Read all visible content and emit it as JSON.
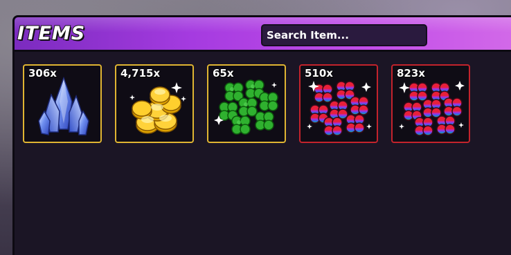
{
  "header": {
    "title": "ITEMS",
    "search_placeholder": "Search Item..."
  },
  "colors": {
    "header_gradient_start": "#7b2bbf",
    "header_gradient_end": "#d36be8",
    "panel_bg": "#1b1525",
    "slot_border_gold": "#e0b532",
    "slot_border_red": "#c4232c"
  },
  "items": [
    {
      "count": "306x",
      "icon": "blue-crystal-icon",
      "rarity_border": "gold"
    },
    {
      "count": "4,715x",
      "icon": "gold-coins-icon",
      "rarity_border": "gold"
    },
    {
      "count": "65x",
      "icon": "green-clover-icon",
      "rarity_border": "gold"
    },
    {
      "count": "510x",
      "icon": "rainbow-clover-icon",
      "rarity_border": "red"
    },
    {
      "count": "823x",
      "icon": "rainbow-clover-icon",
      "rarity_border": "red"
    }
  ]
}
